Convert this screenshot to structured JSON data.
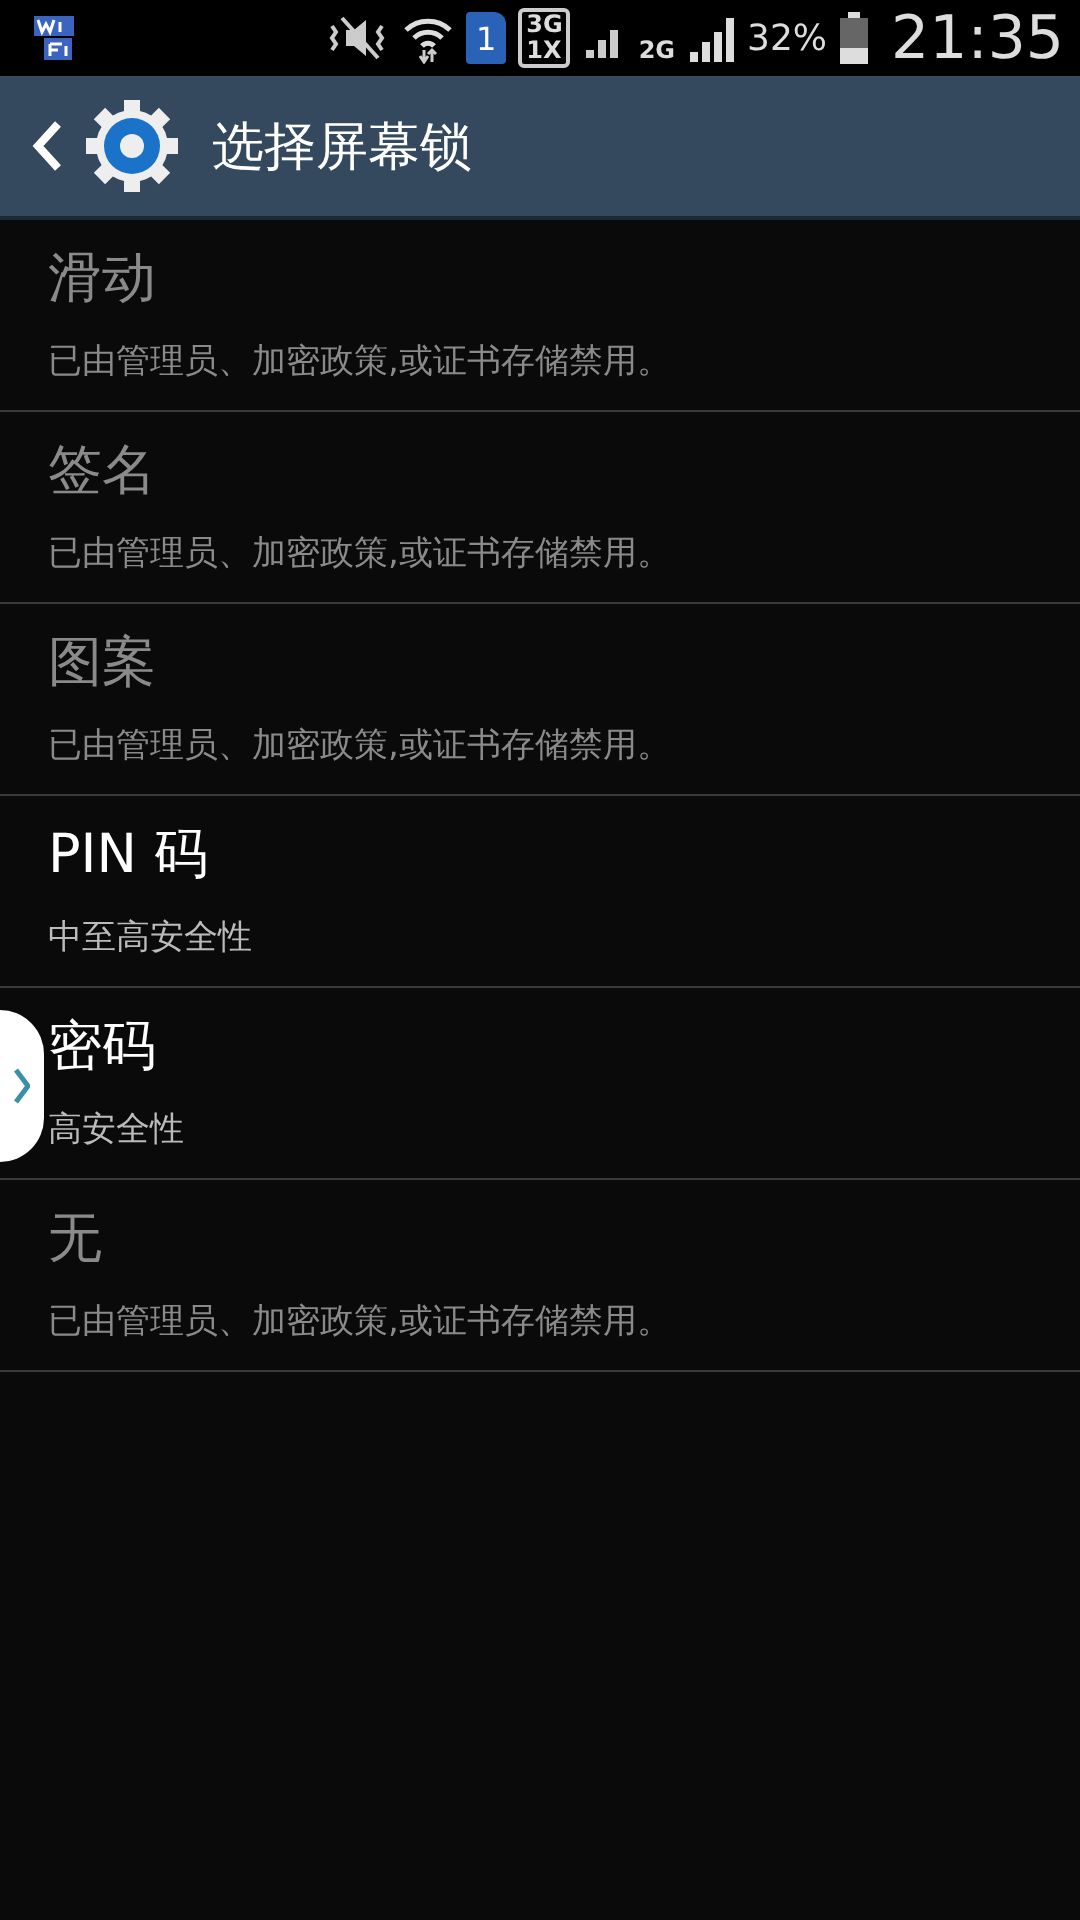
{
  "status_bar": {
    "sim_slot": "1",
    "network_top": "3G",
    "network_bottom": "1X",
    "network_second": "2G",
    "battery": "32%",
    "time": "21:35"
  },
  "action_bar": {
    "title": "选择屏幕锁"
  },
  "options": [
    {
      "title": "滑动",
      "summary": "已由管理员、加密政策,或证书存储禁用。",
      "disabled": true
    },
    {
      "title": "签名",
      "summary": "已由管理员、加密政策,或证书存储禁用。",
      "disabled": true
    },
    {
      "title": "图案",
      "summary": "已由管理员、加密政策,或证书存储禁用。",
      "disabled": true
    },
    {
      "title": "PIN 码",
      "summary": "中至高安全性",
      "disabled": false
    },
    {
      "title": "密码",
      "summary": "高安全性",
      "disabled": false
    },
    {
      "title": "无",
      "summary": "已由管理员、加密政策,或证书存储禁用。",
      "disabled": true
    }
  ]
}
